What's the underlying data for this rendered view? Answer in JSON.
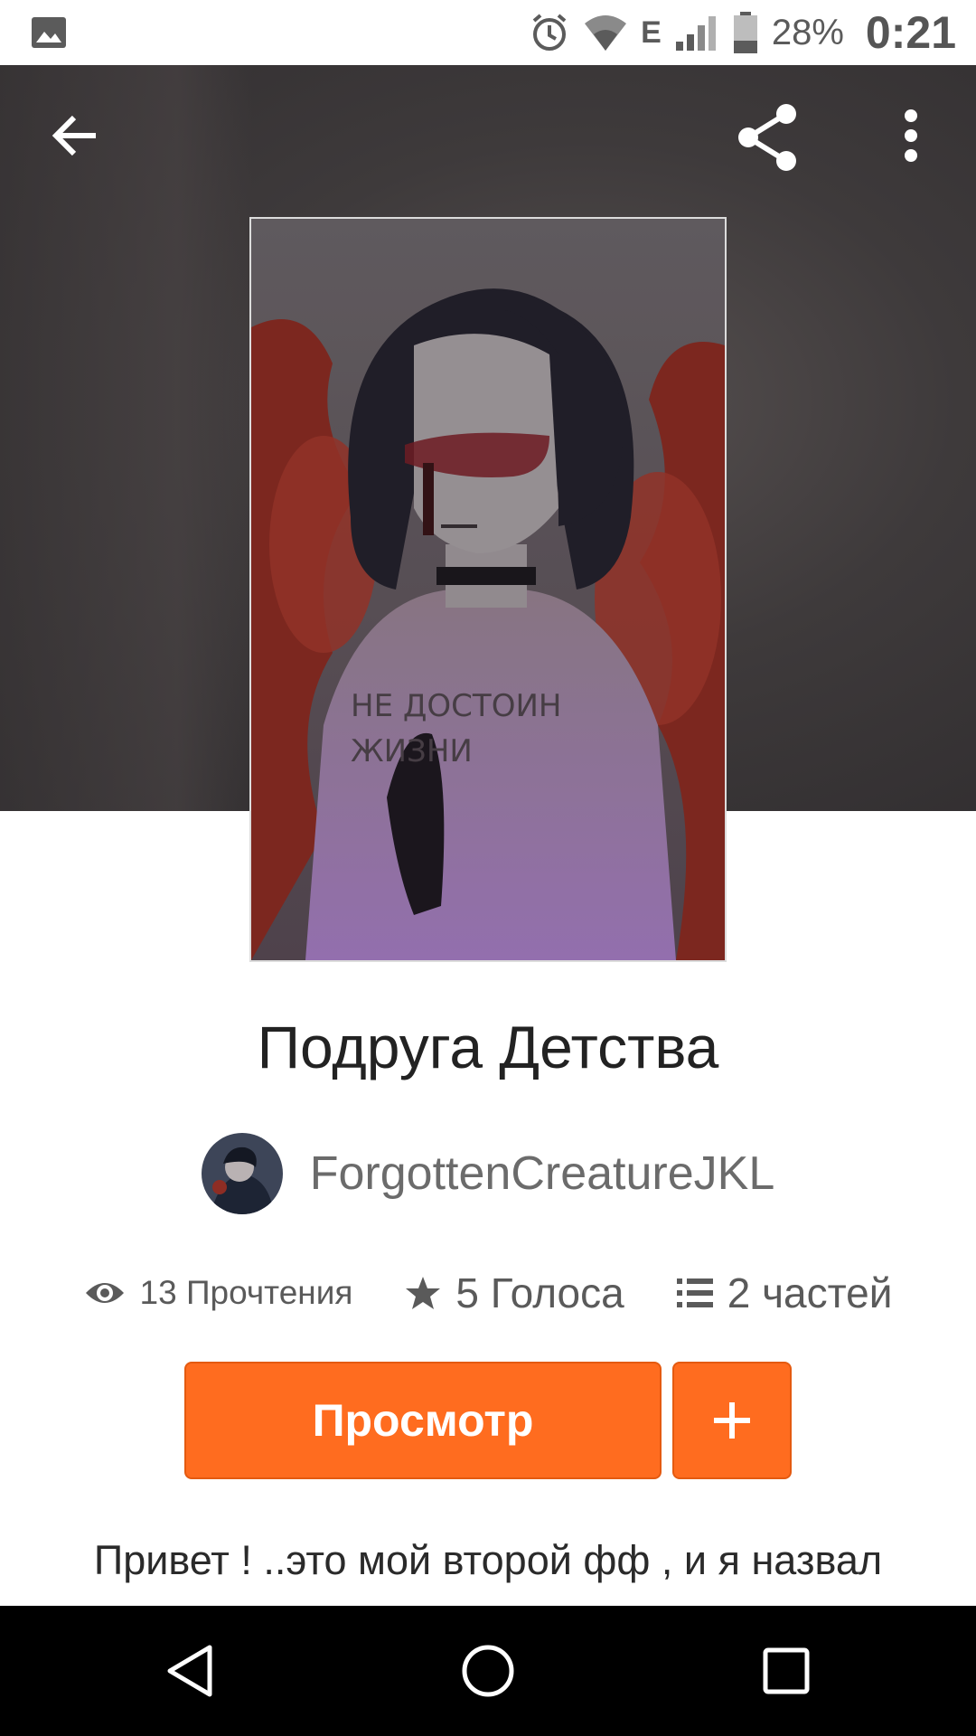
{
  "status_bar": {
    "battery_percent": "28%",
    "time": "0:21",
    "network": "E",
    "icons": [
      "gallery-icon",
      "alarm-icon",
      "wifi-icon",
      "signal-icon",
      "battery-icon"
    ]
  },
  "toolbar": {
    "back_icon": "arrow-left-icon",
    "share_icon": "share-icon",
    "more_icon": "more-vertical-icon"
  },
  "story": {
    "title": "Подруга Детства",
    "author": "ForgottenCreatureJKL",
    "cover_text_line1": "НЕ ДОСТОИН",
    "cover_text_line2": "ЖИЗНИ",
    "reads": "13 Прочтения",
    "votes": "5 Голоса",
    "parts": "2 частей",
    "read_button": "Просмотр",
    "add_button": "+",
    "description": "Привет ! ..это мой второй фф , и я назвал"
  },
  "colors": {
    "accent": "#ff6c1f",
    "hero_bg": "#3e3a3b",
    "navbar_bg": "#000000"
  },
  "navbar": {
    "icons": [
      "nav-back-icon",
      "nav-home-icon",
      "nav-recents-icon"
    ]
  }
}
